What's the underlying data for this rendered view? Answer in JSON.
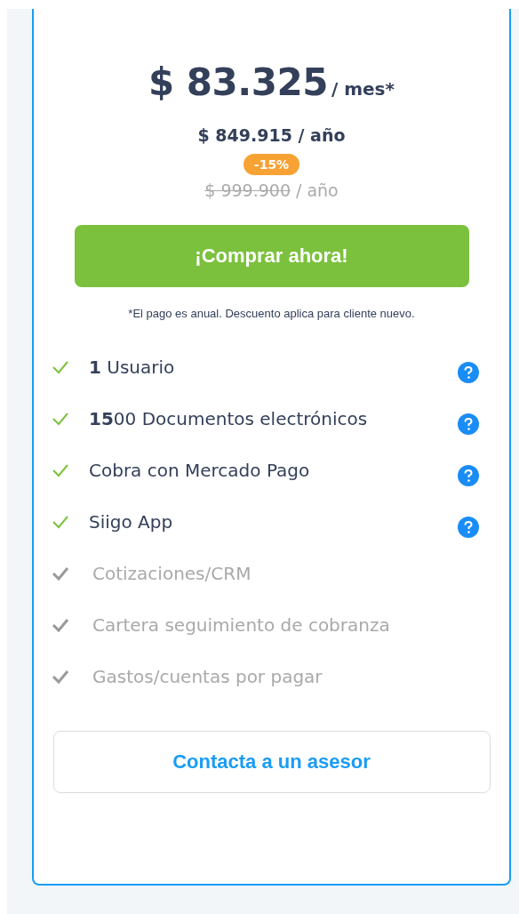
{
  "price": {
    "amount": "$ 83.325",
    "period": "/ mes*"
  },
  "annual_price": "$ 849.915 / año",
  "discount_badge": "-15%",
  "original_price": {
    "amount": "$ 999.900",
    "period": "/ año"
  },
  "buy_button": "¡Comprar ahora!",
  "note": "*El pago es anual. Descuento aplica para cliente nuevo.",
  "features": [
    {
      "text": "**1** Usuario",
      "included": true,
      "help": true
    },
    {
      "text": "**15**00 Documentos electrónicos",
      "included": true,
      "help": true
    },
    {
      "text": "Cobra con Mercado Pago",
      "included": true,
      "help": true
    },
    {
      "text": "Siigo App",
      "included": true,
      "help": true
    },
    {
      "text": "Cotizaciones/CRM",
      "included": false,
      "help": false
    },
    {
      "text": "Cartera seguimiento de cobranza",
      "included": false,
      "help": false
    },
    {
      "text": "Gastos/cuentas por pagar",
      "included": false,
      "help": false
    }
  ],
  "contact_button": "Contacta a un asesor"
}
